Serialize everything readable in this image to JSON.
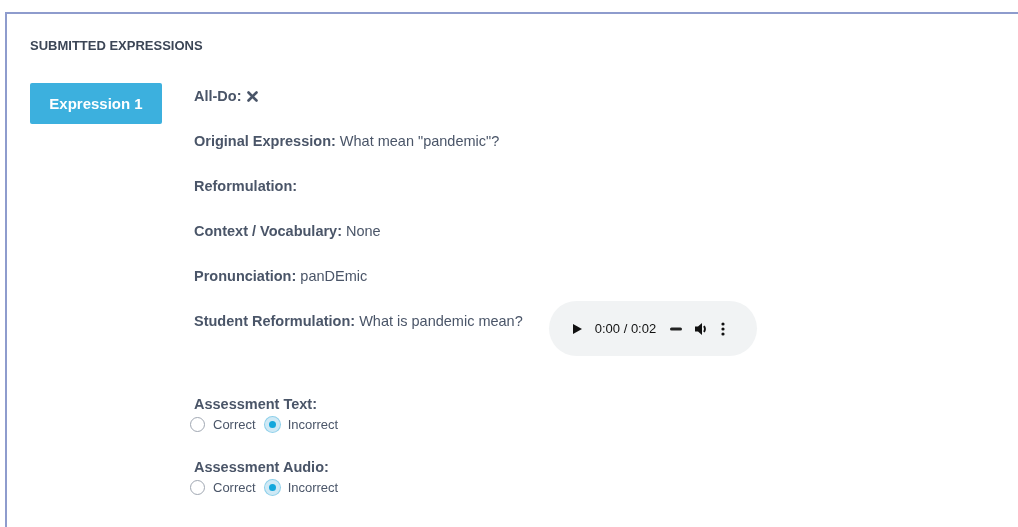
{
  "section_title": "SUBMITTED EXPRESSIONS",
  "expressions": [
    {
      "label": "Expression 1",
      "selected": true
    }
  ],
  "fields": [
    {
      "kind": "check",
      "label": "All-Do:",
      "done": false
    },
    {
      "kind": "text",
      "label": "Original Expression:",
      "value": "What mean \"pandemic\"?"
    },
    {
      "kind": "text",
      "label": "Reformulation:"
    },
    {
      "kind": "text",
      "label": "Context / Vocabulary:",
      "value": "None"
    },
    {
      "kind": "text",
      "label": "Pronunciation:",
      "value": "panDEmic"
    },
    {
      "kind": "audio",
      "label": "Student Reformulation:",
      "value": "What is pandemic mean?",
      "time": "0:00 / 0:02"
    }
  ],
  "assessments": [
    {
      "label": "Assessment Text:",
      "options": [
        {
          "label": "Correct",
          "selected": false
        },
        {
          "label": "Incorrect",
          "selected": true
        }
      ]
    },
    {
      "label": "Assessment Audio:",
      "options": [
        {
          "label": "Correct",
          "selected": false
        },
        {
          "label": "Incorrect",
          "selected": true
        }
      ]
    }
  ]
}
